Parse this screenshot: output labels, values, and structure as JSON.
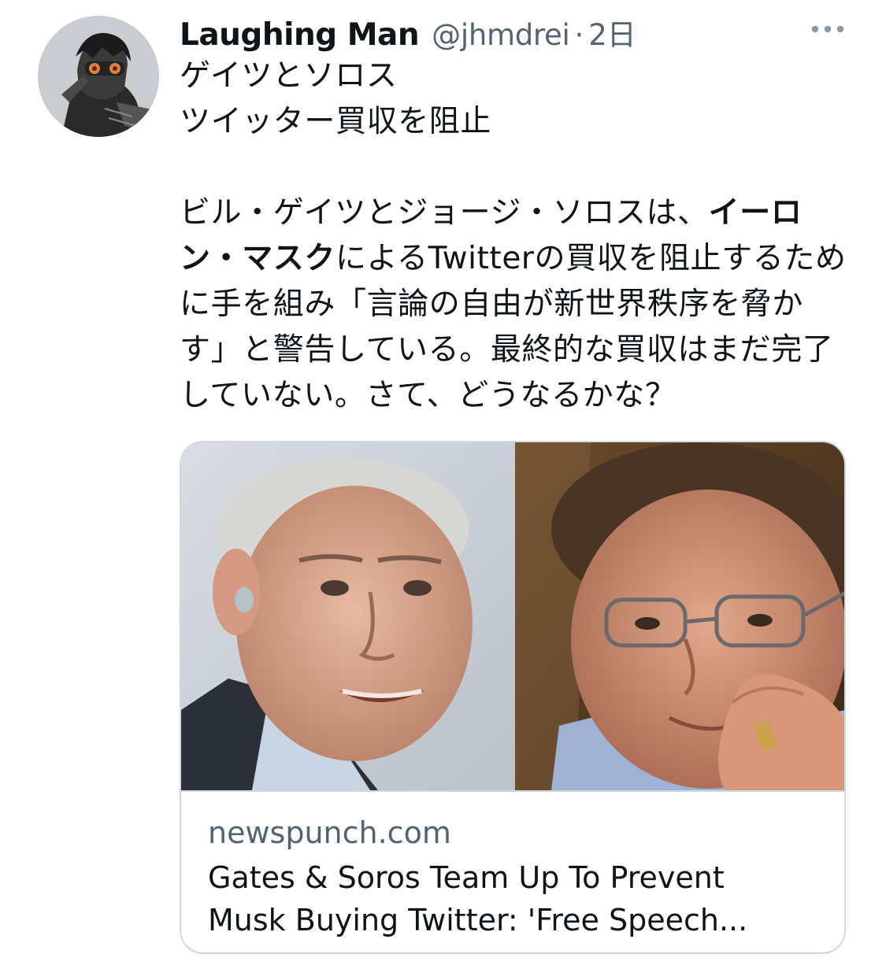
{
  "tweet": {
    "display_name": "Laughing Man",
    "handle": "@jhmdrei",
    "separator": "·",
    "timestamp": "2日",
    "more_icon": "more-horizontal-icon",
    "text": {
      "line1": "ゲイツとソロス",
      "line2": "ツイッター買収を阻止",
      "para_before_bold": "ビル・ゲイツとジョージ・ソロスは、",
      "para_bold": "イーロン・マスク",
      "para_after_bold": "によるTwitterの買収を阻止するために手を組み「言論の自由が新世界秩序を脅かす」と警告している。最終的な買収はまだ完了していない。さて、どうなるかな？"
    },
    "card": {
      "domain": "newspunch.com",
      "title": "Gates & Soros Team Up To Prevent\nMusk Buying Twitter: 'Free Speech..."
    }
  },
  "colors": {
    "text_primary": "#0f1419",
    "text_secondary": "#536471",
    "border": "#cfd9de"
  }
}
